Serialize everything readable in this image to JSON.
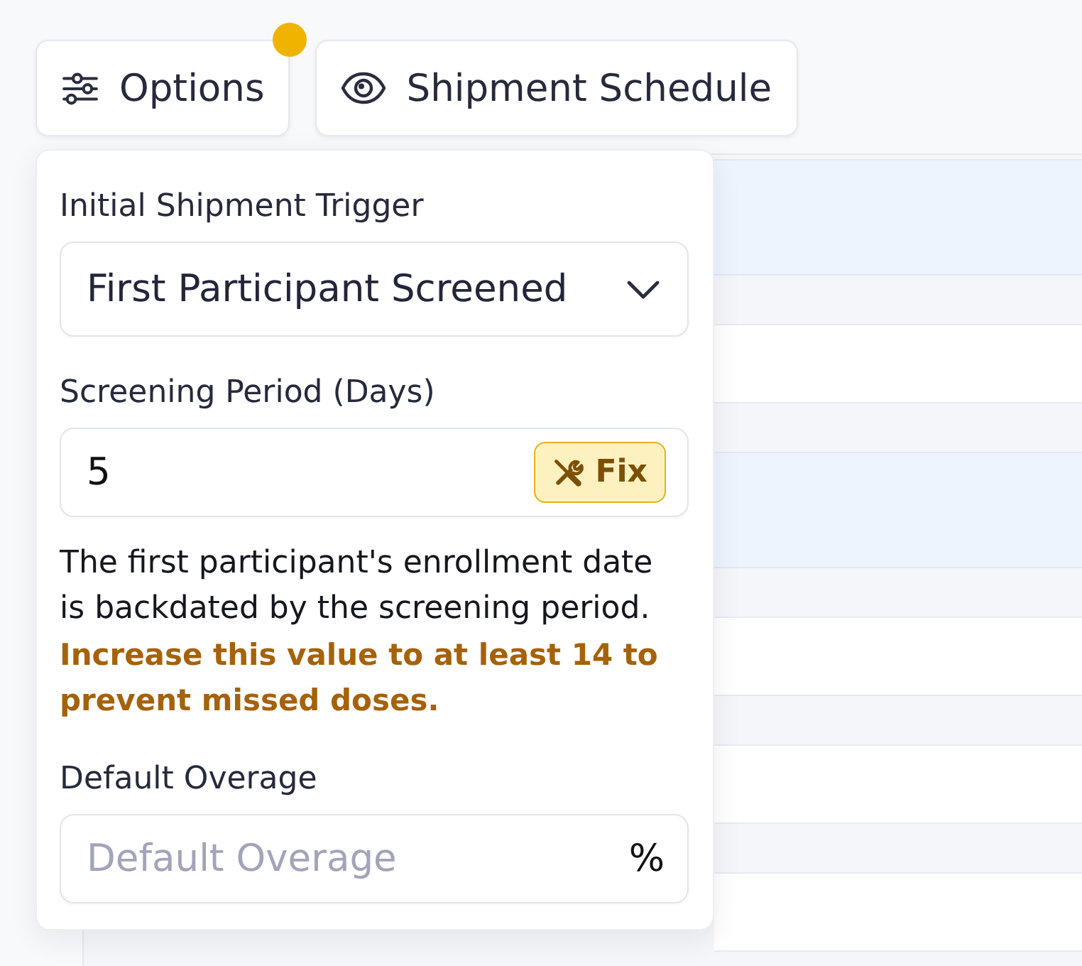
{
  "toolbar": [
    {
      "kind": "options",
      "label": "Options",
      "attention": true
    },
    {
      "kind": "view",
      "label": "Shipment Schedule",
      "attention": false
    }
  ],
  "options_panel": {
    "fields": [
      {
        "kind": "select",
        "label": "Initial Shipment Trigger",
        "value": "First Participant Screened"
      },
      {
        "kind": "number",
        "label": "Screening Period (Days)",
        "value": "5",
        "action": "Fix",
        "help": "The first participant's enrollment date is backdated by the screening period.",
        "warning": "Increase this value to at least 14 to prevent missed doses."
      },
      {
        "kind": "percent",
        "label": "Default Overage",
        "placeholder": "Default Overage",
        "suffix": "%"
      }
    ]
  },
  "background_table": {
    "rows": [
      {
        "highlighted": true
      },
      {
        "highlighted": false
      },
      {
        "highlighted": true
      },
      {
        "highlighted": false
      },
      {
        "highlighted": false
      },
      {
        "highlighted": false
      }
    ]
  }
}
